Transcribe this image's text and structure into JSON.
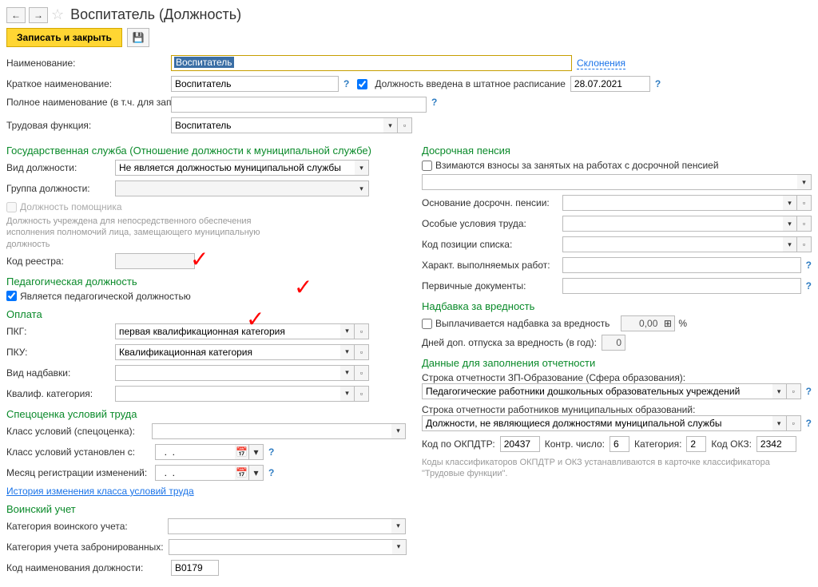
{
  "header": {
    "title": "Воспитатель (Должность)"
  },
  "toolbar": {
    "save_close": "Записать и закрыть"
  },
  "top": {
    "name_label": "Наименование:",
    "name_value": "Воспитатель",
    "decl_link": "Склонения",
    "short_label": "Краткое наименование:",
    "short_value": "Воспитатель",
    "inserted_label": "Должность введена в штатное расписание",
    "inserted_date": "28.07.2021",
    "full_label": "Полное наименование (в т.ч. для записей о трудовой деятельности):",
    "full_value": "",
    "func_label": "Трудовая функция:",
    "func_value": "Воспитатель"
  },
  "gov": {
    "section": "Государственная служба (Отношение должности к муниципальной службе)",
    "type_label": "Вид должности:",
    "type_value": "Не является должностью муниципальной службы",
    "group_label": "Группа должности:",
    "group_value": "",
    "assistant": "Должность помощника",
    "note": "Должность учреждена для непосредственного обеспечения исполнения полномочий лица, замещающего муниципальную должность",
    "reg_label": "Код реестра:",
    "reg_value": ""
  },
  "ped": {
    "section": "Педагогическая должность",
    "is_ped": "Является педагогической должностью"
  },
  "pay": {
    "section": "Оплата",
    "pkg_label": "ПКГ:",
    "pkg_value": "первая квалификационная категория",
    "pku_label": "ПКУ:",
    "pku_value": "Квалификационная категория",
    "bonus_label": "Вид надбавки:",
    "bonus_value": "",
    "qual_label": "Квалиф. категория:",
    "qual_value": ""
  },
  "spec": {
    "section": "Спецоценка условий труда",
    "class_label": "Класс условий (спецоценка):",
    "class_value": "",
    "from_label": "Класс условий установлен с:",
    "from_value": "  .  .    ",
    "month_label": "Месяц регистрации изменений:",
    "month_value": "  .  .    ",
    "history_link": "История изменения класса условий труда"
  },
  "mil": {
    "section": "Воинский учет",
    "cat_label": "Категория воинского учета:",
    "cat_value": "",
    "cat2_label": "Категория учета забронированных:",
    "cat2_value": "",
    "code_label": "Код наименования должности:",
    "code_value": "В0179"
  },
  "pension": {
    "section": "Досрочная пенсия",
    "contrib": "Взимаются взносы за занятых на работах с досрочной пенсией",
    "base_label": "Основание досрочн. пенсии:",
    "cond_label": "Особые условия труда:",
    "pos_label": "Код позиции списка:",
    "char_label": "Характ. выполняемых работ:",
    "docs_label": "Первичные документы:"
  },
  "hazard": {
    "section": "Надбавка за вредность",
    "paid": "Выплачивается надбавка за вредность",
    "paid_value": "0,00",
    "percent": "%",
    "days_label": "Дней доп. отпуска за вредность (в год):",
    "days_value": "0"
  },
  "report": {
    "section": "Данные для заполнения отчетности",
    "row1_label": "Строка отчетности ЗП-Образование (Сфера образования):",
    "row1_value": "Педагогические работники дошкольных образовательных учреждений",
    "row2_label": "Строка отчетности работников муниципальных образований:",
    "row2_value": "Должности, не являющиеся должностями муниципальной службы",
    "okpdtr_label": "Код по ОКПДТР:",
    "okpdtr_value": "20437",
    "kontr_label": "Контр. число:",
    "kontr_value": "6",
    "cat_label": "Категория:",
    "cat_value": "2",
    "okz_label": "Код ОКЗ:",
    "okz_value": "2342",
    "note": "Коды классификаторов ОКПДТР и ОКЗ устанавливаются в карточке классификатора \"Трудовые функции\"."
  }
}
